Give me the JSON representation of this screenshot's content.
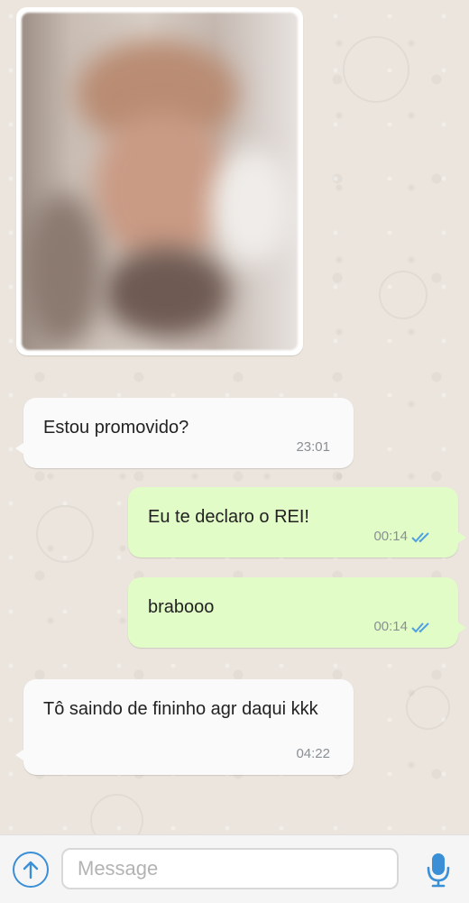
{
  "chat": {
    "image_message": {
      "description_hidden": true
    },
    "messages": [
      {
        "direction": "incoming",
        "text": "Estou promovido?",
        "time": "23:01"
      },
      {
        "direction": "outgoing",
        "text": "Eu te declaro o REI!",
        "time": "00:14",
        "status": "read"
      },
      {
        "direction": "outgoing",
        "text": "brabooo",
        "time": "00:14",
        "status": "read"
      },
      {
        "direction": "incoming",
        "text": "Tô saindo de fininho agr daqui kkk",
        "time": "04:22"
      }
    ]
  },
  "composer": {
    "placeholder": "Message",
    "attach_icon": "upload-arrow-icon",
    "mic_icon": "microphone-icon"
  },
  "colors": {
    "incoming_bubble": "#fafafa",
    "outgoing_bubble": "#e1fcc6",
    "accent": "#3a8fd6",
    "read_ticks": "#4f9fe3"
  }
}
